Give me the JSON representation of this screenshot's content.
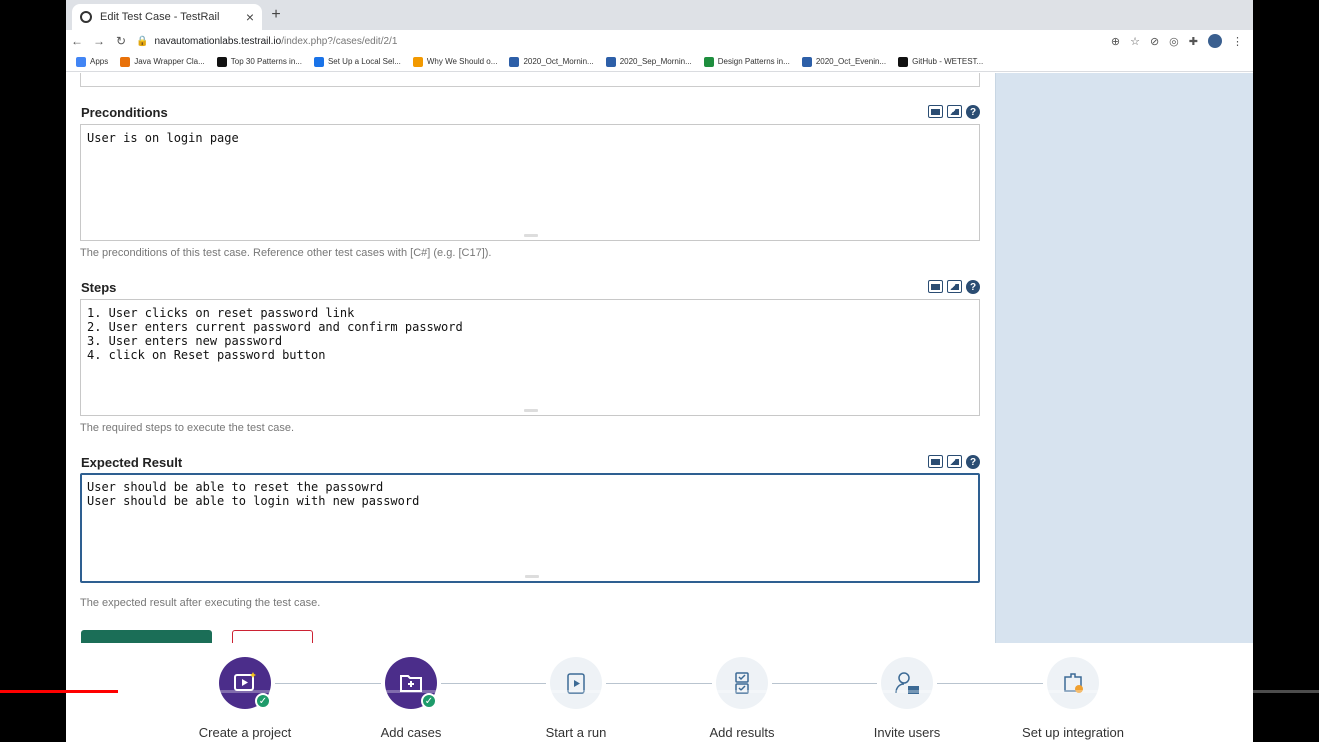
{
  "browser": {
    "tab_title": "Edit Test Case - TestRail",
    "tab_close": "×",
    "new_tab": "+",
    "url_host": "navautomationlabs.testrail.io",
    "url_path": "/index.php?/cases/edit/2/1",
    "bookmarks": [
      {
        "label": "Apps",
        "color": "#4285f4"
      },
      {
        "label": "Java Wrapper Cla...",
        "color": "#e8710a"
      },
      {
        "label": "Top 30 Patterns in...",
        "color": "#111111"
      },
      {
        "label": "Set Up a Local Sel...",
        "color": "#1a73e8"
      },
      {
        "label": "Why We Should o...",
        "color": "#f29900"
      },
      {
        "label": "2020_Oct_Mornin...",
        "color": "#2d5fa8"
      },
      {
        "label": "2020_Sep_Mornin...",
        "color": "#2d5fa8"
      },
      {
        "label": "Design Patterns in...",
        "color": "#1e8e3e"
      },
      {
        "label": "2020_Oct_Evenin...",
        "color": "#2d5fa8"
      },
      {
        "label": "GitHub - WETEST...",
        "color": "#111111"
      }
    ]
  },
  "form": {
    "preconditions": {
      "label": "Preconditions",
      "lines": [
        "User is on login page"
      ],
      "hint": "The preconditions of this test case. Reference other test cases with [C#] (e.g. [C17])."
    },
    "steps": {
      "label": "Steps",
      "lines": [
        "1. User clicks on reset password link",
        "2. User enters current password and confirm password",
        "3. User enters new password",
        "4. click on Reset password button"
      ],
      "hint": "The required steps to execute the test case."
    },
    "expected": {
      "label": "Expected Result",
      "lines": [
        "User should be able to reset the passowrd",
        "User should be able to login with new password"
      ],
      "hint": "The expected result after executing the test case."
    },
    "help_glyph": "?"
  },
  "onboarding": {
    "steps": [
      {
        "label": "Create a project",
        "done": true
      },
      {
        "label": "Add cases",
        "done": true
      },
      {
        "label": "Start a run",
        "done": false
      },
      {
        "label": "Add results",
        "done": false
      },
      {
        "label": "Invite users",
        "done": false
      },
      {
        "label": "Set up integration",
        "done": false
      }
    ],
    "check_glyph": "✓"
  },
  "colors": {
    "accent": "#2b4d73",
    "sidebar": "#d7e3ef",
    "done_step": "#4b2d8a",
    "video_progress": "#ff0000"
  }
}
